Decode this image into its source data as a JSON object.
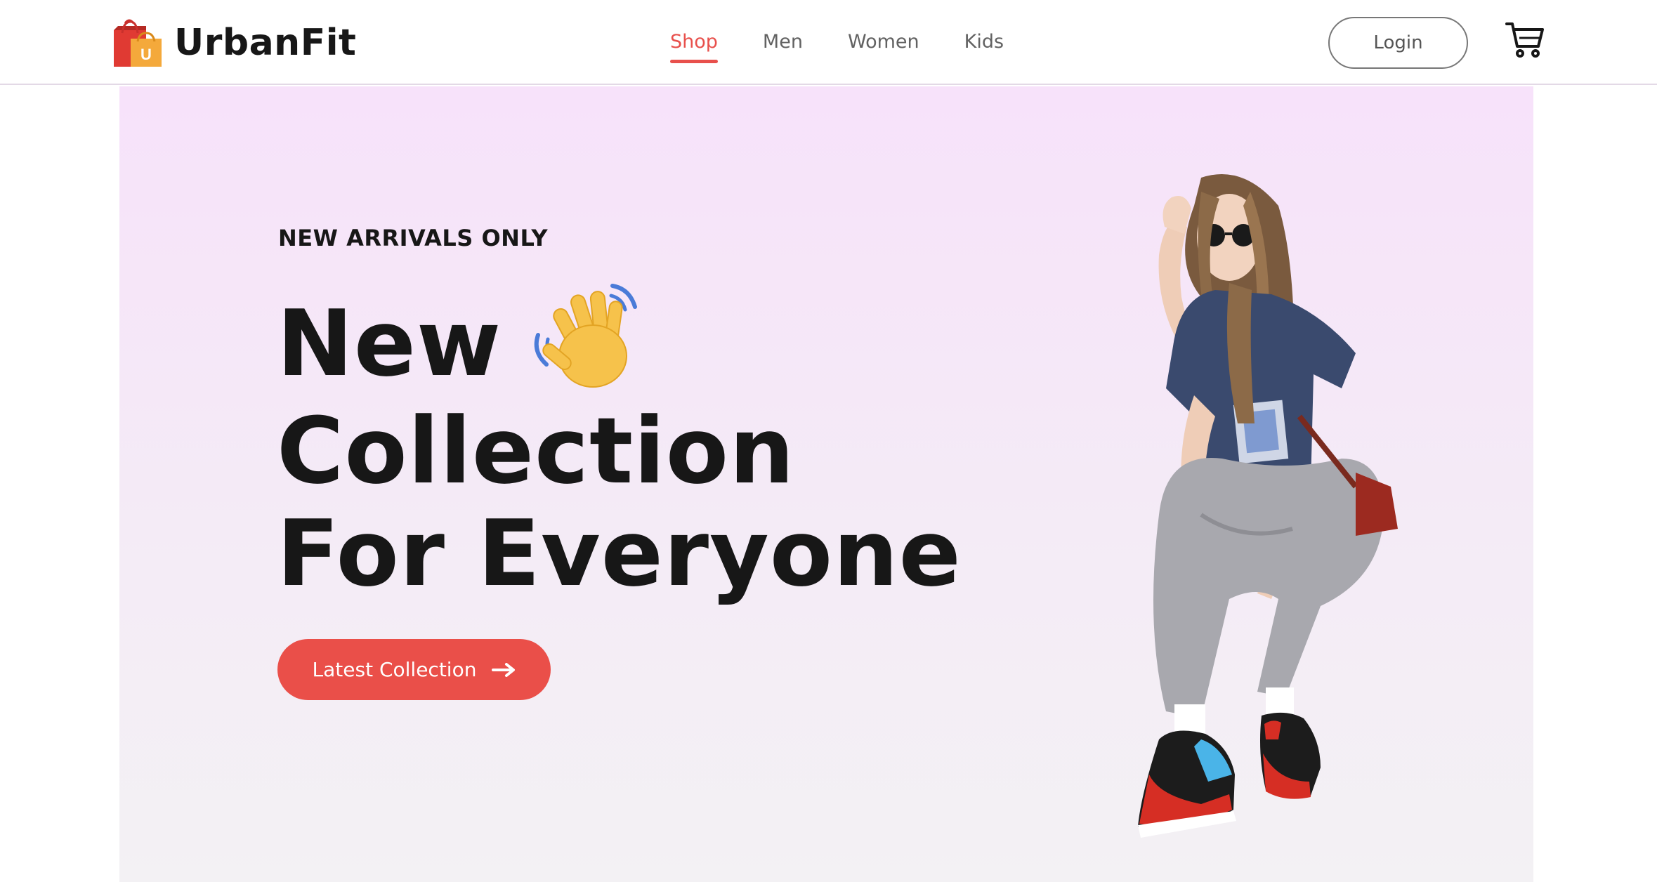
{
  "navbar": {
    "brand": {
      "name": "UrbanFit",
      "logo_icon": "shopping-bag-icon",
      "logo_letter": "U"
    },
    "menu": [
      {
        "label": "Shop",
        "active": true
      },
      {
        "label": "Men",
        "active": false
      },
      {
        "label": "Women",
        "active": false
      },
      {
        "label": "Kids",
        "active": false
      }
    ],
    "login_label": "Login",
    "cart_icon": "cart-icon"
  },
  "hero": {
    "eyebrow": "NEW ARRIVALS ONLY",
    "headline": {
      "line1": "New",
      "line2": "Collection",
      "line3": "For Everyone"
    },
    "emoji_icon": "waving-hand-icon",
    "cta_label": "Latest Collection",
    "cta_icon": "arrow-right-icon",
    "image": "model-in-sneakers-photo"
  },
  "colors": {
    "accent": "#ea4f49",
    "text": "#171717",
    "nav_inactive": "#626262",
    "hero_bg_top": "#f7e2fa",
    "hero_bg_bottom": "#f3f1f4"
  }
}
